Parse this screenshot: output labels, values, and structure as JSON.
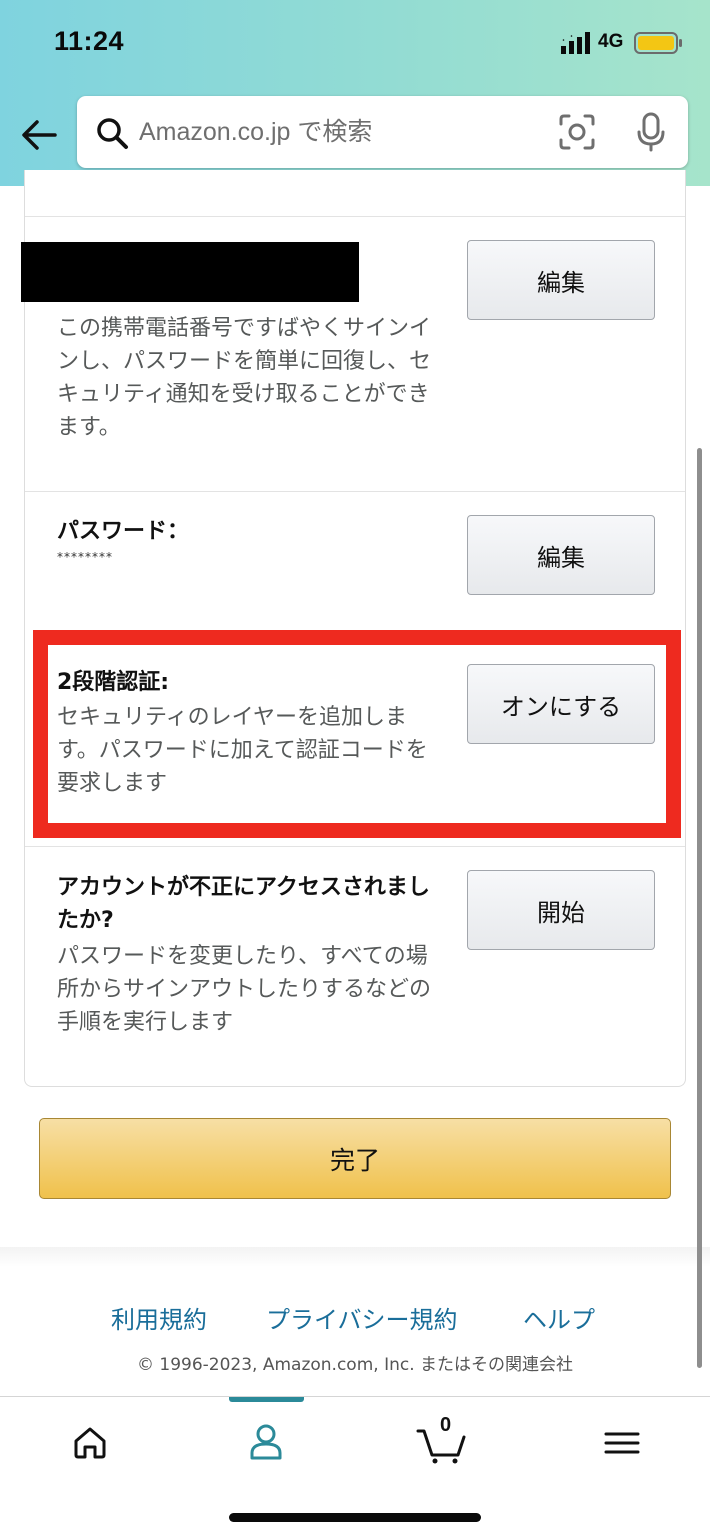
{
  "status_bar": {
    "time": "11:24",
    "network": "4G"
  },
  "search": {
    "placeholder": "Amazon.co.jp で検索"
  },
  "rows": {
    "phone": {
      "description": "この携帯電話番号ですばやくサインインし、パスワードを簡単に回復し、セキュリティ通知を受け取ることができます。",
      "button": "編集"
    },
    "password": {
      "title": "パスワード：",
      "mask": "********",
      "button": "編集"
    },
    "two_step": {
      "title": "2段階認証:",
      "description": "セキュリティのレイヤーを追加します。パスワードに加えて認証コードを要求します",
      "button": "オンにする"
    },
    "compromised": {
      "title": "アカウントが不正にアクセスされましたか?",
      "description": "パスワードを変更したり、すべての場所からサインアウトしたりするなどの手順を実行します",
      "button": "開始"
    }
  },
  "done_button": "完了",
  "footer": {
    "links": [
      "利用規約",
      "プライバシー規約",
      "ヘルプ"
    ],
    "copyright": "© 1996-2023, Amazon.com, Inc. またはその関連会社"
  },
  "tab_bar": {
    "cart_count": "0",
    "active": "account"
  },
  "colors": {
    "highlight": "#ee2a1f",
    "accent": "#2b8a99",
    "link": "#1a6e9a",
    "primary_button": "#f0c14b"
  }
}
